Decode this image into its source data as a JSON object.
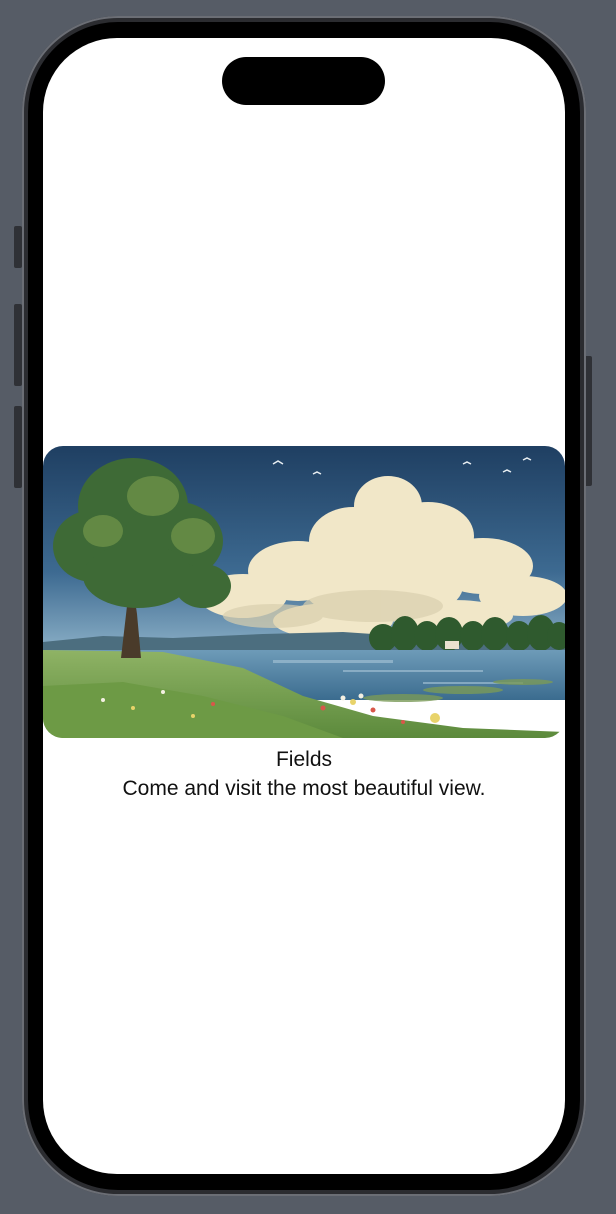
{
  "card": {
    "title": "Fields",
    "subtitle": "Come and visit the most beautiful view.",
    "image": "landscape-painting-tree-lake-clouds"
  },
  "colors": {
    "background": "#565c66",
    "screen": "#ffffff",
    "sky": "#2f5478",
    "cloud": "#f3ead0",
    "grass": "#7fa35a",
    "lake": "#4d7fa3"
  }
}
